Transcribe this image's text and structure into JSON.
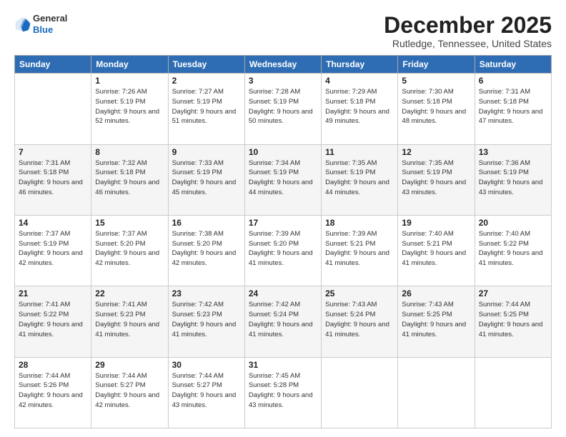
{
  "header": {
    "logo_general": "General",
    "logo_blue": "Blue",
    "month_title": "December 2025",
    "location": "Rutledge, Tennessee, United States"
  },
  "days_of_week": [
    "Sunday",
    "Monday",
    "Tuesday",
    "Wednesday",
    "Thursday",
    "Friday",
    "Saturday"
  ],
  "weeks": [
    [
      {
        "day": "",
        "sunrise": "",
        "sunset": "",
        "daylight": ""
      },
      {
        "day": "1",
        "sunrise": "Sunrise: 7:26 AM",
        "sunset": "Sunset: 5:19 PM",
        "daylight": "Daylight: 9 hours and 52 minutes."
      },
      {
        "day": "2",
        "sunrise": "Sunrise: 7:27 AM",
        "sunset": "Sunset: 5:19 PM",
        "daylight": "Daylight: 9 hours and 51 minutes."
      },
      {
        "day": "3",
        "sunrise": "Sunrise: 7:28 AM",
        "sunset": "Sunset: 5:19 PM",
        "daylight": "Daylight: 9 hours and 50 minutes."
      },
      {
        "day": "4",
        "sunrise": "Sunrise: 7:29 AM",
        "sunset": "Sunset: 5:18 PM",
        "daylight": "Daylight: 9 hours and 49 minutes."
      },
      {
        "day": "5",
        "sunrise": "Sunrise: 7:30 AM",
        "sunset": "Sunset: 5:18 PM",
        "daylight": "Daylight: 9 hours and 48 minutes."
      },
      {
        "day": "6",
        "sunrise": "Sunrise: 7:31 AM",
        "sunset": "Sunset: 5:18 PM",
        "daylight": "Daylight: 9 hours and 47 minutes."
      }
    ],
    [
      {
        "day": "7",
        "sunrise": "Sunrise: 7:31 AM",
        "sunset": "Sunset: 5:18 PM",
        "daylight": "Daylight: 9 hours and 46 minutes."
      },
      {
        "day": "8",
        "sunrise": "Sunrise: 7:32 AM",
        "sunset": "Sunset: 5:18 PM",
        "daylight": "Daylight: 9 hours and 46 minutes."
      },
      {
        "day": "9",
        "sunrise": "Sunrise: 7:33 AM",
        "sunset": "Sunset: 5:19 PM",
        "daylight": "Daylight: 9 hours and 45 minutes."
      },
      {
        "day": "10",
        "sunrise": "Sunrise: 7:34 AM",
        "sunset": "Sunset: 5:19 PM",
        "daylight": "Daylight: 9 hours and 44 minutes."
      },
      {
        "day": "11",
        "sunrise": "Sunrise: 7:35 AM",
        "sunset": "Sunset: 5:19 PM",
        "daylight": "Daylight: 9 hours and 44 minutes."
      },
      {
        "day": "12",
        "sunrise": "Sunrise: 7:35 AM",
        "sunset": "Sunset: 5:19 PM",
        "daylight": "Daylight: 9 hours and 43 minutes."
      },
      {
        "day": "13",
        "sunrise": "Sunrise: 7:36 AM",
        "sunset": "Sunset: 5:19 PM",
        "daylight": "Daylight: 9 hours and 43 minutes."
      }
    ],
    [
      {
        "day": "14",
        "sunrise": "Sunrise: 7:37 AM",
        "sunset": "Sunset: 5:19 PM",
        "daylight": "Daylight: 9 hours and 42 minutes."
      },
      {
        "day": "15",
        "sunrise": "Sunrise: 7:37 AM",
        "sunset": "Sunset: 5:20 PM",
        "daylight": "Daylight: 9 hours and 42 minutes."
      },
      {
        "day": "16",
        "sunrise": "Sunrise: 7:38 AM",
        "sunset": "Sunset: 5:20 PM",
        "daylight": "Daylight: 9 hours and 42 minutes."
      },
      {
        "day": "17",
        "sunrise": "Sunrise: 7:39 AM",
        "sunset": "Sunset: 5:20 PM",
        "daylight": "Daylight: 9 hours and 41 minutes."
      },
      {
        "day": "18",
        "sunrise": "Sunrise: 7:39 AM",
        "sunset": "Sunset: 5:21 PM",
        "daylight": "Daylight: 9 hours and 41 minutes."
      },
      {
        "day": "19",
        "sunrise": "Sunrise: 7:40 AM",
        "sunset": "Sunset: 5:21 PM",
        "daylight": "Daylight: 9 hours and 41 minutes."
      },
      {
        "day": "20",
        "sunrise": "Sunrise: 7:40 AM",
        "sunset": "Sunset: 5:22 PM",
        "daylight": "Daylight: 9 hours and 41 minutes."
      }
    ],
    [
      {
        "day": "21",
        "sunrise": "Sunrise: 7:41 AM",
        "sunset": "Sunset: 5:22 PM",
        "daylight": "Daylight: 9 hours and 41 minutes."
      },
      {
        "day": "22",
        "sunrise": "Sunrise: 7:41 AM",
        "sunset": "Sunset: 5:23 PM",
        "daylight": "Daylight: 9 hours and 41 minutes."
      },
      {
        "day": "23",
        "sunrise": "Sunrise: 7:42 AM",
        "sunset": "Sunset: 5:23 PM",
        "daylight": "Daylight: 9 hours and 41 minutes."
      },
      {
        "day": "24",
        "sunrise": "Sunrise: 7:42 AM",
        "sunset": "Sunset: 5:24 PM",
        "daylight": "Daylight: 9 hours and 41 minutes."
      },
      {
        "day": "25",
        "sunrise": "Sunrise: 7:43 AM",
        "sunset": "Sunset: 5:24 PM",
        "daylight": "Daylight: 9 hours and 41 minutes."
      },
      {
        "day": "26",
        "sunrise": "Sunrise: 7:43 AM",
        "sunset": "Sunset: 5:25 PM",
        "daylight": "Daylight: 9 hours and 41 minutes."
      },
      {
        "day": "27",
        "sunrise": "Sunrise: 7:44 AM",
        "sunset": "Sunset: 5:25 PM",
        "daylight": "Daylight: 9 hours and 41 minutes."
      }
    ],
    [
      {
        "day": "28",
        "sunrise": "Sunrise: 7:44 AM",
        "sunset": "Sunset: 5:26 PM",
        "daylight": "Daylight: 9 hours and 42 minutes."
      },
      {
        "day": "29",
        "sunrise": "Sunrise: 7:44 AM",
        "sunset": "Sunset: 5:27 PM",
        "daylight": "Daylight: 9 hours and 42 minutes."
      },
      {
        "day": "30",
        "sunrise": "Sunrise: 7:44 AM",
        "sunset": "Sunset: 5:27 PM",
        "daylight": "Daylight: 9 hours and 43 minutes."
      },
      {
        "day": "31",
        "sunrise": "Sunrise: 7:45 AM",
        "sunset": "Sunset: 5:28 PM",
        "daylight": "Daylight: 9 hours and 43 minutes."
      },
      {
        "day": "",
        "sunrise": "",
        "sunset": "",
        "daylight": ""
      },
      {
        "day": "",
        "sunrise": "",
        "sunset": "",
        "daylight": ""
      },
      {
        "day": "",
        "sunrise": "",
        "sunset": "",
        "daylight": ""
      }
    ]
  ]
}
